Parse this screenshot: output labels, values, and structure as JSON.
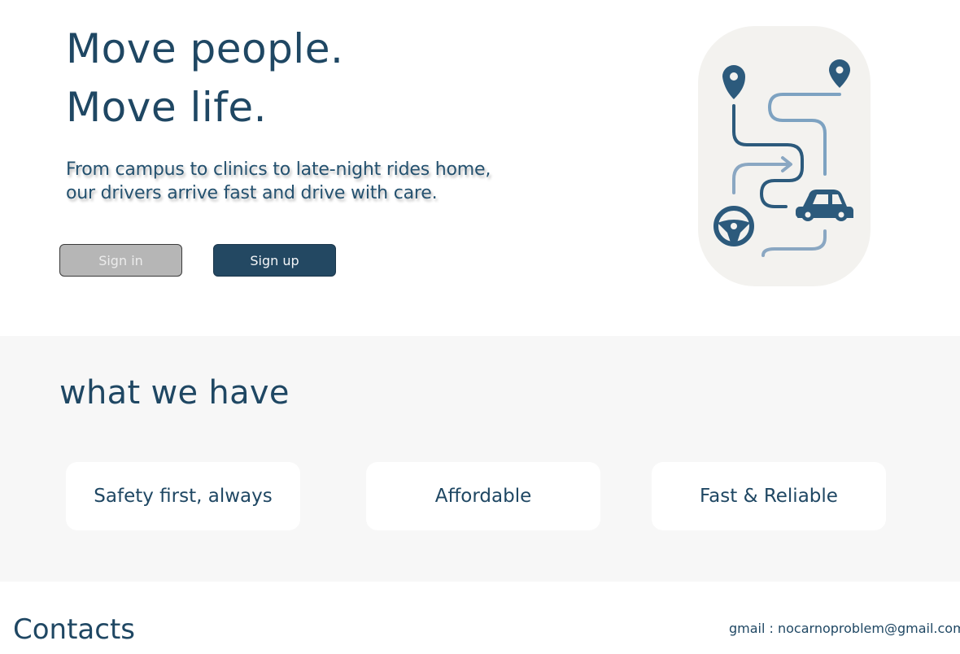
{
  "hero": {
    "headline_line1": "Move people.",
    "headline_line2": "Move life.",
    "subtitle_line1": "From campus to clinics to late-night rides home,",
    "subtitle_line2": "our drivers arrive fast and drive with care.",
    "signin_label": "Sign in",
    "signup_label": "Sign up",
    "illustration_icons": [
      "map-pin-icon",
      "map-pin-icon",
      "route-path-icon",
      "car-icon",
      "steering-wheel-icon"
    ]
  },
  "features": {
    "title": "what we have",
    "cards": [
      {
        "label": "Safety first, always"
      },
      {
        "label": "Affordable"
      },
      {
        "label": "Fast & Reliable"
      }
    ]
  },
  "contacts": {
    "title": "Contacts",
    "email_text": "gmail : nocarnoproblem@gmail.com"
  },
  "colors": {
    "brand_navy": "#1f4763",
    "signup_bg": "#234862",
    "signin_bg": "#b6b6b6",
    "section_bg": "#f7f7f7",
    "illustration_bg": "#f3f2ef",
    "route_light": "#8aa7c2"
  }
}
